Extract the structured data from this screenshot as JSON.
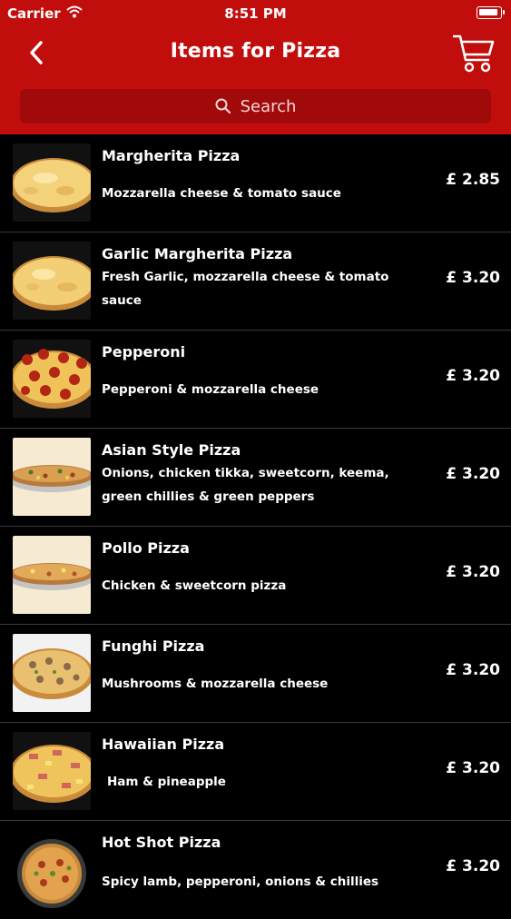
{
  "status_bar": {
    "carrier": "Carrier",
    "time": "8:51 PM"
  },
  "nav": {
    "title": "Items for Pizza"
  },
  "search": {
    "label": "Search"
  },
  "colors": {
    "header_red": "#c20d0d",
    "search_red": "#a10a0a",
    "list_background": "#000000"
  },
  "items": [
    {
      "name": "Margherita Pizza",
      "description": "Mozzarella cheese & tomato sauce",
      "price": "£ 2.85"
    },
    {
      "name": "Garlic Margherita Pizza",
      "description": "Fresh Garlic, mozzarella cheese & tomato sauce",
      "price": "£ 3.20"
    },
    {
      "name": "Pepperoni",
      "description": "Pepperoni & mozzarella cheese",
      "price": "£ 3.20"
    },
    {
      "name": "Asian Style Pizza",
      "description": "Onions, chicken tikka, sweetcorn, keema, green chillies & green peppers",
      "price": "£ 3.20"
    },
    {
      "name": "Pollo Pizza",
      "description": "Chicken & sweetcorn pizza",
      "price": "£ 3.20"
    },
    {
      "name": "Funghi Pizza",
      "description": "Mushrooms & mozzarella cheese",
      "price": "£ 3.20"
    },
    {
      "name": "Hawaiian Pizza",
      "description": "Ham & pineapple",
      "price": "£ 3.20"
    },
    {
      "name": "Hot Shot Pizza",
      "description": "Spicy lamb, pepperoni, onions & chillies",
      "price": "£ 3.20"
    }
  ]
}
